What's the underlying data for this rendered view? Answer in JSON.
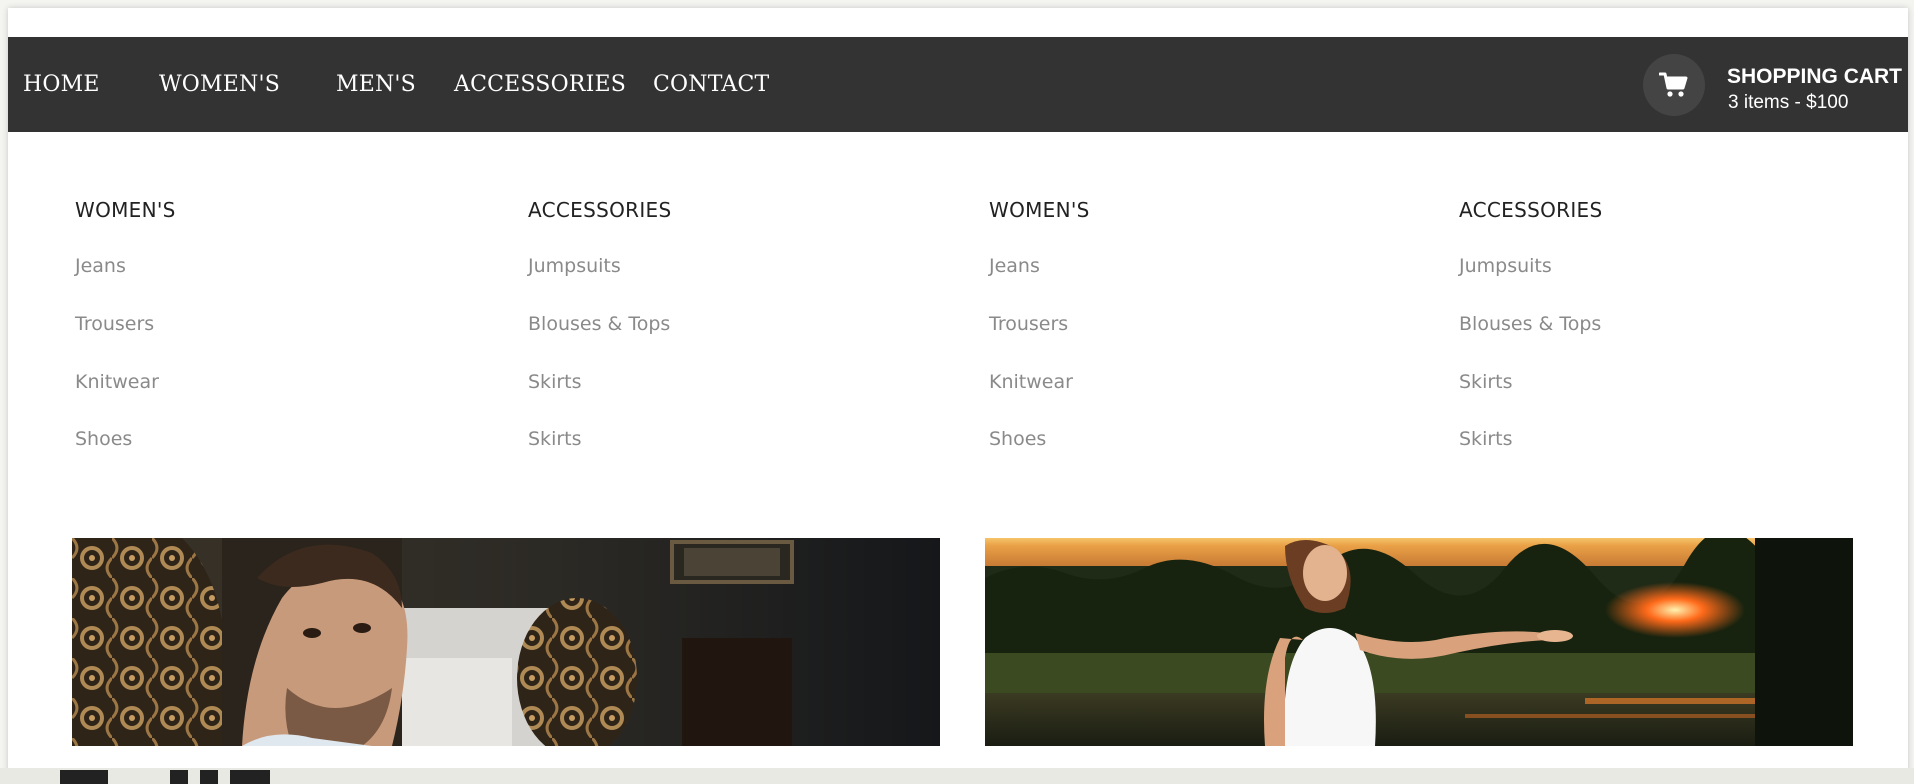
{
  "nav": {
    "items": [
      {
        "label": "HOME"
      },
      {
        "label": "WOMEN'S"
      },
      {
        "label": "MEN'S"
      },
      {
        "label": "ACCESSORIES"
      },
      {
        "label": "CONTACT"
      }
    ]
  },
  "cart": {
    "icon": "cart-icon",
    "title": "SHOPPING CART",
    "info": "3 items - $100"
  },
  "mega_menu": {
    "columns": [
      {
        "title": "WOMEN'S",
        "links": [
          "Jeans",
          "Trousers",
          "Knitwear",
          "Shoes"
        ]
      },
      {
        "title": "ACCESSORIES",
        "links": [
          "Jumpsuits",
          "Blouses & Tops",
          "Skirts",
          "Skirts"
        ]
      },
      {
        "title": "WOMEN'S",
        "links": [
          "Jeans",
          "Trousers",
          "Knitwear",
          "Shoes"
        ]
      },
      {
        "title": "ACCESSORIES",
        "links": [
          "Jumpsuits",
          "Blouses & Tops",
          "Skirts",
          "Skirts"
        ]
      }
    ],
    "banners": [
      {
        "name": "men-banner-image"
      },
      {
        "name": "women-banner-image"
      }
    ]
  },
  "colors": {
    "navbar": "#333333",
    "nav_text": "#ffffff",
    "heading": "#222222",
    "link": "#8a8a8a"
  }
}
